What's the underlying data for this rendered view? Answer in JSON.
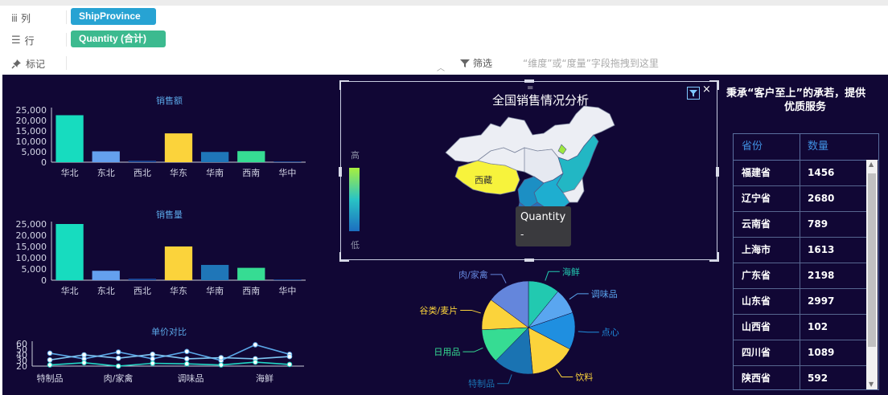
{
  "shelf": {
    "columns": {
      "label": "列",
      "pill": "ShipProvince",
      "pill_color": "#27a3d3"
    },
    "rows": {
      "label": "行",
      "pill": "Quantity (合计)",
      "pill_color": "#3cba8f"
    },
    "marks": {
      "label": "标记"
    },
    "filter": {
      "label": "筛选",
      "hint": "“维度”或“度量”字段拖拽到这里"
    }
  },
  "colors": {
    "background": "#110735",
    "bar_teal": "#17dcbf",
    "bar_blue": "#64a0ee",
    "bar_yellow": "#fbd33b",
    "bar_steel": "#1f76b8",
    "bar_green": "#36dc93",
    "bar_darkblue": "#1c4796",
    "title_blue": "#5aa6e6"
  },
  "map": {
    "title": "全国销售情况分析",
    "legend_high": "高",
    "legend_low": "低",
    "tooltip_title": "Quantity",
    "tooltip_value": "-",
    "highlight_label": "西藏"
  },
  "slogan": {
    "line1": "秉承“客户至上”的承若，提供",
    "line2": "优质服务"
  },
  "table": {
    "headers": [
      "省份",
      "数量"
    ],
    "rows": [
      {
        "province": "福建省",
        "qty": "1456"
      },
      {
        "province": "辽宁省",
        "qty": "2680"
      },
      {
        "province": "云南省",
        "qty": "789"
      },
      {
        "province": "上海市",
        "qty": "1613"
      },
      {
        "province": "广东省",
        "qty": "2198"
      },
      {
        "province": "山东省",
        "qty": "2997"
      },
      {
        "province": "山西省",
        "qty": "102"
      },
      {
        "province": "四川省",
        "qty": "1089"
      },
      {
        "province": "陕西省",
        "qty": "592"
      }
    ]
  },
  "chart_data": [
    {
      "type": "bar",
      "title": "销售额",
      "categories": [
        "华北",
        "东北",
        "西北",
        "华东",
        "华南",
        "西南",
        "华中"
      ],
      "values": [
        22500,
        5200,
        700,
        13800,
        4900,
        5300,
        200
      ],
      "ylim": [
        0,
        25000
      ],
      "yticks": [
        "0",
        "5,000",
        "10,000",
        "15,000",
        "20,000",
        "25,000"
      ]
    },
    {
      "type": "bar",
      "title": "销售量",
      "categories": [
        "华北",
        "东北",
        "西北",
        "华东",
        "华南",
        "西南",
        "华中"
      ],
      "values": [
        25000,
        4200,
        700,
        15000,
        6800,
        5500,
        200
      ],
      "ylim": [
        0,
        25000
      ],
      "yticks": [
        "0",
        "5,000",
        "10,000",
        "15,000",
        "20,000",
        "25,000"
      ]
    },
    {
      "type": "line",
      "title": "单价对比",
      "categories": [
        "特制品",
        "肉/家禽",
        "调味品",
        "海鲜"
      ],
      "ylim": [
        20,
        60
      ],
      "yticks": [
        "20",
        "30",
        "40",
        "50",
        "60"
      ],
      "series": [
        {
          "color": "#5aa6e6",
          "values": [
            43,
            33,
            45,
            33,
            46,
            30,
            58,
            41
          ]
        },
        {
          "color": "#7ec5f2",
          "values": [
            31,
            40,
            34,
            41,
            33,
            35,
            33,
            37
          ]
        },
        {
          "color": "#22d6c4",
          "values": [
            22,
            26,
            20,
            25,
            24,
            22,
            27,
            23
          ]
        }
      ]
    },
    {
      "type": "pie",
      "categories": [
        "海鲜",
        "调味品",
        "点心",
        "饮料",
        "特制品",
        "日用品",
        "谷类/麦片",
        "肉/家禽"
      ],
      "values": [
        11,
        9,
        13,
        16,
        14,
        12,
        11,
        15
      ]
    }
  ]
}
